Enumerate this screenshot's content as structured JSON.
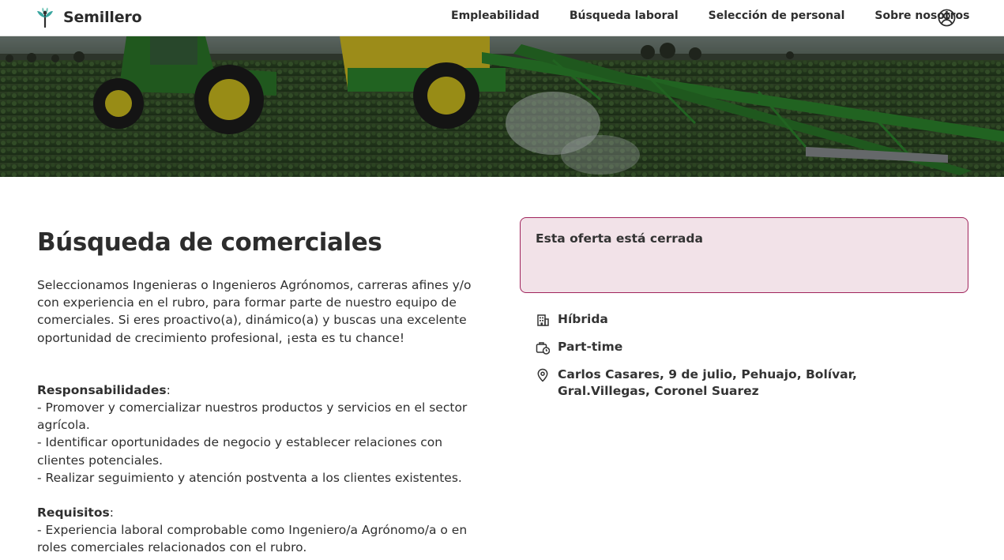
{
  "header": {
    "brand": "Semillero",
    "nav": [
      "Empleabilidad",
      "Búsqueda laboral",
      "Selección de personal",
      "Sobre nosotros"
    ],
    "account_icon": "user-circle-icon"
  },
  "hero": {
    "description_icon": "tractor-field-photo"
  },
  "job": {
    "title": "Búsqueda de comerciales",
    "intro": "Seleccionamos Ingenieras o Ingenieros Agrónomos, carreras afines y/o con experiencia en el rubro, para formar parte de nuestro equipo de comerciales. Si eres proactivo(a), dinámico(a) y buscas una excelente oportunidad de crecimiento profesional, ¡esta es tu chance!",
    "responsibilities": {
      "heading": "Responsabilidades",
      "items": [
        "- Promover y comercializar nuestros productos y servicios en el sector agrícola.",
        "- Identificar oportunidades de negocio y establecer relaciones con clientes potenciales.",
        "- Realizar seguimiento y atención postventa a los clientes existentes."
      ]
    },
    "requirements": {
      "heading": "Requisitos",
      "items": [
        "- Experiencia laboral comprobable como Ingeniero/a Agrónomo/a o en roles comerciales relacionados con el rubro."
      ]
    }
  },
  "status": {
    "closed_text": "Esta oferta está cerrada"
  },
  "details": {
    "modality": "Híbrida",
    "schedule": "Part-time",
    "locations": "Carlos Casares, 9 de julio, Pehuajo, Bolívar, Gral.Villegas, Coronel Suarez"
  },
  "colors": {
    "closed_bg": "#f2e2e8",
    "closed_border": "#a0245c",
    "logo_accent": "#3aa6a0"
  }
}
